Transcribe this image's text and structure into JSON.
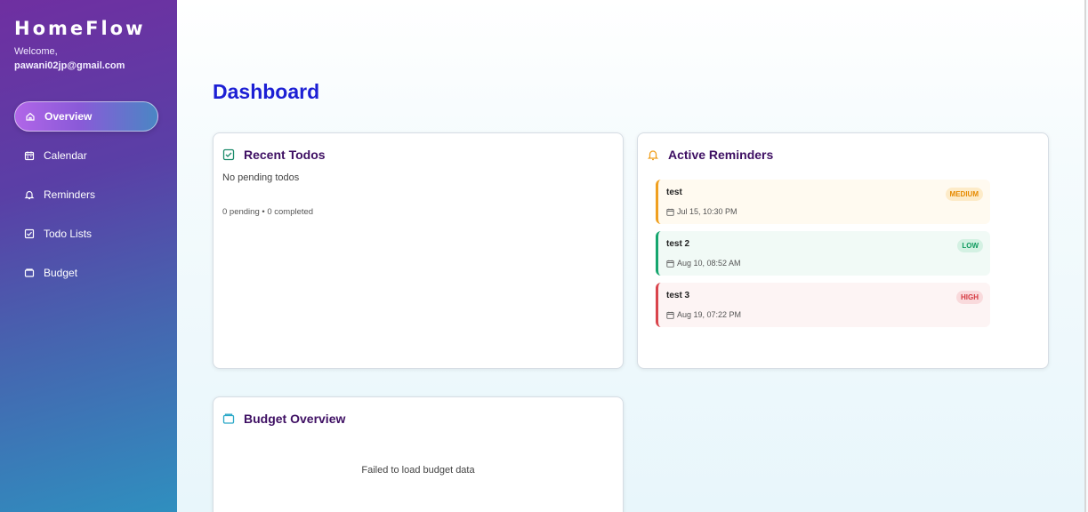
{
  "sidebar": {
    "brand": "HomeFlow",
    "welcome": "Welcome,",
    "email": "pawani02jp@gmail.com",
    "items": [
      {
        "label": "Overview",
        "icon": "home-icon",
        "active": true
      },
      {
        "label": "Calendar",
        "icon": "calendar-icon"
      },
      {
        "label": "Reminders",
        "icon": "bell-icon"
      },
      {
        "label": "Todo Lists",
        "icon": "checkbox-icon"
      },
      {
        "label": "Budget",
        "icon": "wallet-icon"
      }
    ]
  },
  "main": {
    "title": "Dashboard",
    "todos": {
      "title": "Recent Todos",
      "empty": "No pending todos",
      "stats": "0 pending • 0 completed"
    },
    "reminders": {
      "title": "Active Reminders",
      "items": [
        {
          "title": "test",
          "date": "Jul 15, 10:30 PM",
          "priority": "MEDIUM"
        },
        {
          "title": "test 2",
          "date": "Aug 10, 08:52 AM",
          "priority": "LOW"
        },
        {
          "title": "test 3",
          "date": "Aug 19, 07:22 PM",
          "priority": "HIGH"
        }
      ]
    },
    "budget": {
      "title": "Budget Overview",
      "message": "Failed to load budget data"
    }
  },
  "colors": {
    "title_blue": "#1c1fd4",
    "card_title_purple": "#3e0f63",
    "medium": "#f0a020",
    "low": "#15a56e",
    "high": "#d9444c"
  }
}
